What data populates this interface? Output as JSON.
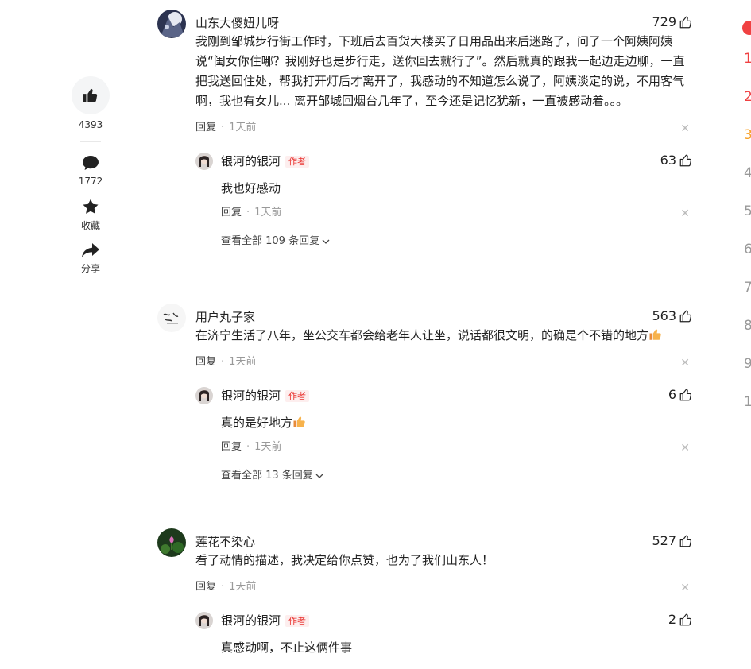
{
  "rail": {
    "like_count": "4393",
    "comment_count": "1772",
    "collect_label": "收藏",
    "share_label": "分享"
  },
  "comments": [
    {
      "username": "山东大傻妞儿呀",
      "likes": "729",
      "text": "我刚到邹城步行街工作时，下班后去百货大楼买了日用品出来后迷路了，问了一个阿姨阿姨说“闺女你住哪？我刚好也是步行走，送你回去就行了”。然后就真的跟我一起边走边聊，一直把我送回住处，帮我打开灯后才离开了，我感动的不知道怎么说了，阿姨淡定的说，不用客气啊，我也有女儿... 离开邹城回烟台几年了，至今还是记忆犹新，一直被感动着。。。",
      "reply_label": "回复",
      "time": "1天前",
      "reply": {
        "username": "银河的银河",
        "author_tag": "作者",
        "likes": "63",
        "text": "我也好感动",
        "reply_label": "回复",
        "time": "1天前"
      },
      "view_all": "查看全部 109 条回复"
    },
    {
      "username": "用户丸子家",
      "likes": "563",
      "text": "在济宁生活了八年，坐公交车都会给老年人让坐，说话都很文明，的确是个不错的地方",
      "reply_label": "回复",
      "time": "1天前",
      "reply": {
        "username": "银河的银河",
        "author_tag": "作者",
        "likes": "6",
        "text": "真的是好地方",
        "reply_label": "回复",
        "time": "1天前"
      },
      "view_all": "查看全部 13 条回复"
    },
    {
      "username": "莲花不染心",
      "likes": "527",
      "text": "看了动情的描述，我决定给你点赞，也为了我们山东人！",
      "reply_label": "回复",
      "time": "1天前",
      "reply": {
        "username": "银河的银河",
        "author_tag": "作者",
        "likes": "2",
        "text": "真感动啊，不止这俩件事"
      }
    }
  ],
  "ranks": [
    "1",
    "2",
    "3",
    "4",
    "5",
    "6",
    "7",
    "8",
    "9",
    "1"
  ],
  "colors": {
    "rank_1": "#f04142",
    "rank_2": "#f04142",
    "rank_3": "#f7a128",
    "rank_other": "#999999",
    "author_tag": "#e9302d"
  }
}
